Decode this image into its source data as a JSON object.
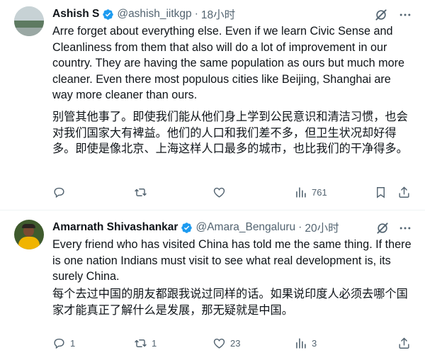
{
  "tweets": [
    {
      "name": "Ashish S",
      "handle": "@ashish_iitkgp",
      "time": "18小时",
      "text_en": "Arre forget about everything else. Even if we learn Civic Sense and Cleanliness from them that also will do a lot of improvement in our country. They are having the same population as ours but much more cleaner. Even there most populous cities like Beijing, Shanghai are way more cleaner than ours.",
      "text_zh": "别管其他事了。即使我们能从他们身上学到公民意识和清洁习惯，也会对我们国家大有裨益。他们的人口和我们差不多，但卫生状况却好得多。即使是像北京、上海这样人口最多的城市，也比我们的干净得多。",
      "replies": "",
      "retweets": "",
      "likes": "",
      "views": "761"
    },
    {
      "name": "Amarnath Shivashankar",
      "handle": "@Amara_Bengaluru",
      "time": "20小时",
      "text_en": "Every friend who has visited China has told me the same thing. If there is one nation Indians must visit to see what real development is, its surely China.",
      "text_zh": "每个去过中国的朋友都跟我说过同样的话。如果说印度人必须去哪个国家才能真正了解什么是发展，那无疑就是中国。",
      "replies": "1",
      "retweets": "1",
      "likes": "23",
      "views": "3"
    }
  ],
  "icons": {
    "verified": "verified-badge-icon",
    "grok": "grok-icon",
    "more": "more-options-icon",
    "reply": "reply-icon",
    "retweet": "retweet-icon",
    "like": "like-icon",
    "views": "views-icon",
    "share": "share-icon"
  },
  "colors": {
    "accent": "#1d9bf0",
    "muted": "#536471",
    "text": "#0f1419",
    "divider": "#eff3f4"
  }
}
